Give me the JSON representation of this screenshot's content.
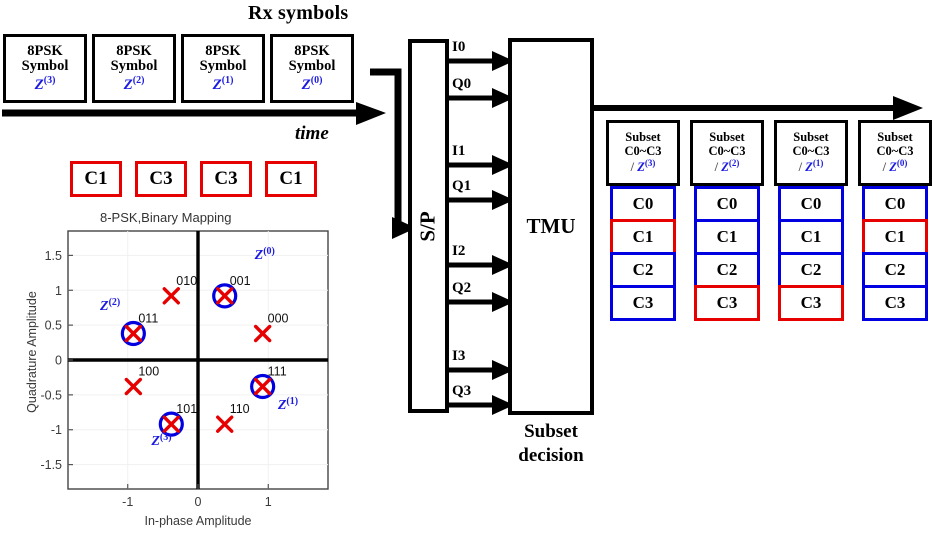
{
  "header": {
    "rx_title": "Rx symbols",
    "time_label": "time"
  },
  "symbols": [
    {
      "line1": "8PSK",
      "line2": "Symbol",
      "z": "Z",
      "sup": "(3)"
    },
    {
      "line1": "8PSK",
      "line2": "Symbol",
      "z": "Z",
      "sup": "(2)"
    },
    {
      "line1": "8PSK",
      "line2": "Symbol",
      "z": "Z",
      "sup": "(1)"
    },
    {
      "line1": "8PSK",
      "line2": "Symbol",
      "z": "Z",
      "sup": "(0)"
    }
  ],
  "decided_subsets": [
    "C1",
    "C3",
    "C3",
    "C1"
  ],
  "blocks": {
    "sp_label": "S/P",
    "tmu_label": "TMU",
    "subset_decision": "Subset\ndecision",
    "subset_decision_l1": "Subset",
    "subset_decision_l2": "decision"
  },
  "io_labels": [
    "I0",
    "Q0",
    "I1",
    "Q1",
    "I2",
    "Q2",
    "I3",
    "Q3"
  ],
  "subset_columns": [
    {
      "head_l1": "Subset",
      "head_l2": "C0~C3",
      "head_slash": "/ ",
      "head_z": "Z",
      "head_sup": "(3)",
      "cells": [
        {
          "label": "C0",
          "state": "blue"
        },
        {
          "label": "C1",
          "state": "red"
        },
        {
          "label": "C2",
          "state": "blue"
        },
        {
          "label": "C3",
          "state": "blue"
        }
      ]
    },
    {
      "head_l1": "Subset",
      "head_l2": "C0~C3",
      "head_slash": "/ ",
      "head_z": "Z",
      "head_sup": "(2)",
      "cells": [
        {
          "label": "C0",
          "state": "blue"
        },
        {
          "label": "C1",
          "state": "blue"
        },
        {
          "label": "C2",
          "state": "blue"
        },
        {
          "label": "C3",
          "state": "red"
        }
      ]
    },
    {
      "head_l1": "Subset",
      "head_l2": "C0~C3",
      "head_slash": "/ ",
      "head_z": "Z",
      "head_sup": "(1)",
      "cells": [
        {
          "label": "C0",
          "state": "blue"
        },
        {
          "label": "C1",
          "state": "blue"
        },
        {
          "label": "C2",
          "state": "blue"
        },
        {
          "label": "C3",
          "state": "red"
        }
      ]
    },
    {
      "head_l1": "Subset",
      "head_l2": "C0~C3",
      "head_slash": "/ ",
      "head_z": "Z",
      "head_sup": "(0)",
      "cells": [
        {
          "label": "C0",
          "state": "blue"
        },
        {
          "label": "C1",
          "state": "red"
        },
        {
          "label": "C2",
          "state": "blue"
        },
        {
          "label": "C3",
          "state": "blue"
        }
      ]
    }
  ],
  "colors": {
    "red": "#e60000",
    "blue": "#0000e0",
    "label_blue": "#1a1ae0",
    "black": "#000000"
  },
  "chart_data": {
    "type": "scatter",
    "title": "8-PSK,Binary Mapping",
    "xlabel": "In-phase Amplitude",
    "ylabel": "Quadrature Amplitude",
    "xlim": [
      -1.85,
      1.85
    ],
    "ylim": [
      -1.85,
      1.85
    ],
    "xticks": [
      -1,
      0,
      1
    ],
    "yticks": [
      1.5,
      1,
      0.5,
      0,
      -0.5,
      -1,
      -1.5
    ],
    "grid": true,
    "points": [
      {
        "label": "001",
        "x": 0.38,
        "y": 0.92,
        "marker": "x",
        "color": "#e60000",
        "circled": true,
        "z": "Z",
        "zsup": "(0)"
      },
      {
        "label": "010",
        "x": -0.38,
        "y": 0.92,
        "marker": "x",
        "color": "#e60000",
        "circled": false
      },
      {
        "label": "011",
        "x": -0.92,
        "y": 0.38,
        "marker": "x",
        "color": "#e60000",
        "circled": true,
        "z": "Z",
        "zsup": "(2)"
      },
      {
        "label": "000",
        "x": 0.92,
        "y": 0.38,
        "marker": "x",
        "color": "#e60000",
        "circled": false
      },
      {
        "label": "100",
        "x": -0.92,
        "y": -0.38,
        "marker": "x",
        "color": "#e60000",
        "circled": false
      },
      {
        "label": "101",
        "x": -0.38,
        "y": -0.92,
        "marker": "x",
        "color": "#e60000",
        "circled": true,
        "z": "Z",
        "zsup": "(3)"
      },
      {
        "label": "110",
        "x": 0.38,
        "y": -0.92,
        "marker": "x",
        "color": "#e60000",
        "circled": false
      },
      {
        "label": "111",
        "x": 0.92,
        "y": -0.38,
        "marker": "x",
        "color": "#e60000",
        "circled": true,
        "z": "Z",
        "zsup": "(1)"
      }
    ],
    "annotations": [
      {
        "text": "Z(0)",
        "x": 0.95,
        "y": 1.45
      },
      {
        "text": "Z(2)",
        "x": -1.25,
        "y": 0.72
      },
      {
        "text": "Z(1)",
        "x": 1.28,
        "y": -0.7
      },
      {
        "text": "Z(3)",
        "x": -0.52,
        "y": -1.22
      }
    ]
  }
}
